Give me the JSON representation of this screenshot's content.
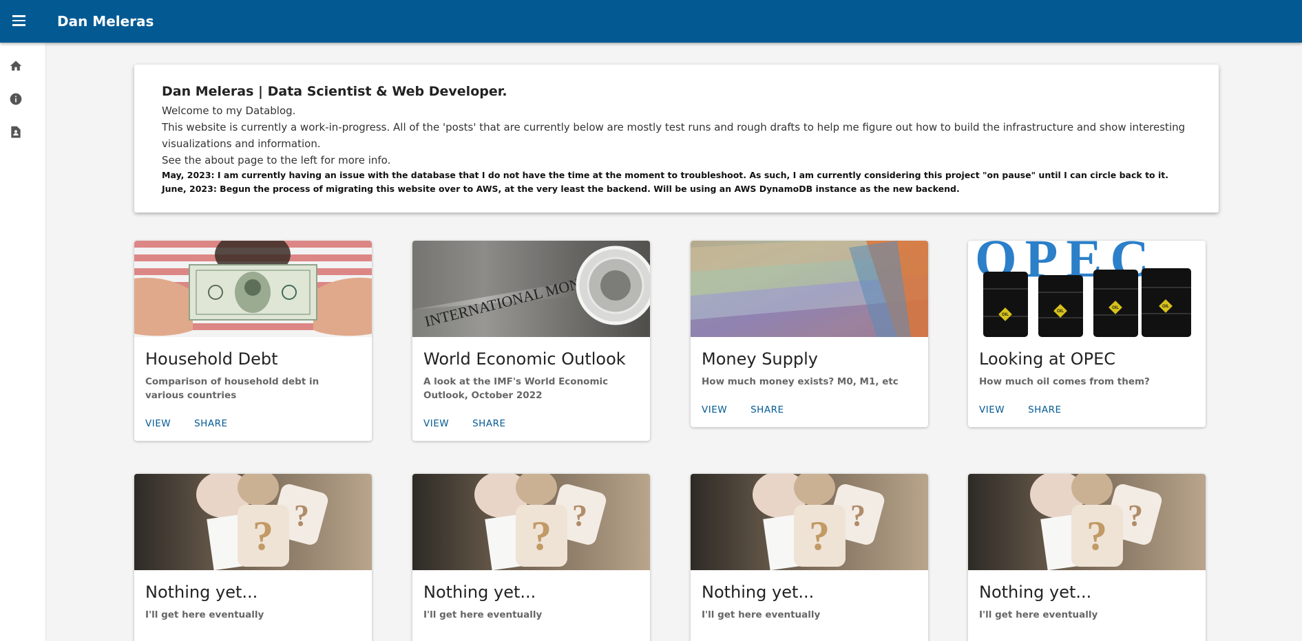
{
  "app": {
    "title": "Dan Meleras"
  },
  "sidebar": {
    "items": [
      {
        "icon": "home-icon"
      },
      {
        "icon": "info-icon"
      },
      {
        "icon": "resume-icon"
      }
    ]
  },
  "intro": {
    "heading": "Dan Meleras | Data Scientist & Web Developer.",
    "welcome": "Welcome to my Datablog.",
    "wip": "This website is currently a work-in-progress. All of the 'posts' that are currently below are mostly test runs and rough drafts to help me figure out how to build the infrastructure and show interesting visualizations and information.",
    "about": "See the about page to the left for more info.",
    "note_may": "May, 2023: I am currently having an issue with the database that I do not have the time at the moment to troubleshoot. As such, I am currently considering this project \"on pause\" until I can circle back to it.",
    "note_june": "June, 2023: Begun the process of migrating this website over to AWS, at the very least the backend. Will be using an AWS DynamoDB instance as the new backend."
  },
  "cards": [
    {
      "title": "Household Debt",
      "description": "Comparison of household debt in various countries",
      "view": "VIEW",
      "share": "SHARE"
    },
    {
      "title": "World Economic Outlook",
      "description": "A look at the IMF's World Economic Outlook, October 2022",
      "view": "VIEW",
      "share": "SHARE",
      "image_text": "INTERNATIONAL MONETARY FUND"
    },
    {
      "title": "Money Supply",
      "description": "How much money exists? M0, M1, etc",
      "view": "VIEW",
      "share": "SHARE"
    },
    {
      "title": "Looking at OPEC",
      "description": "How much oil comes from them?",
      "view": "VIEW",
      "share": "SHARE",
      "image_text": "OPEC",
      "barrel_label": "OIL"
    },
    {
      "title": "Nothing yet...",
      "description": "I'll get here eventually"
    },
    {
      "title": "Nothing yet...",
      "description": "I'll get here eventually"
    },
    {
      "title": "Nothing yet...",
      "description": "I'll get here eventually"
    },
    {
      "title": "Nothing yet...",
      "description": "I'll get here eventually"
    }
  ],
  "colors": {
    "appbar": "#035a93",
    "accent": "#035a93",
    "background": "#f4f4f4"
  }
}
